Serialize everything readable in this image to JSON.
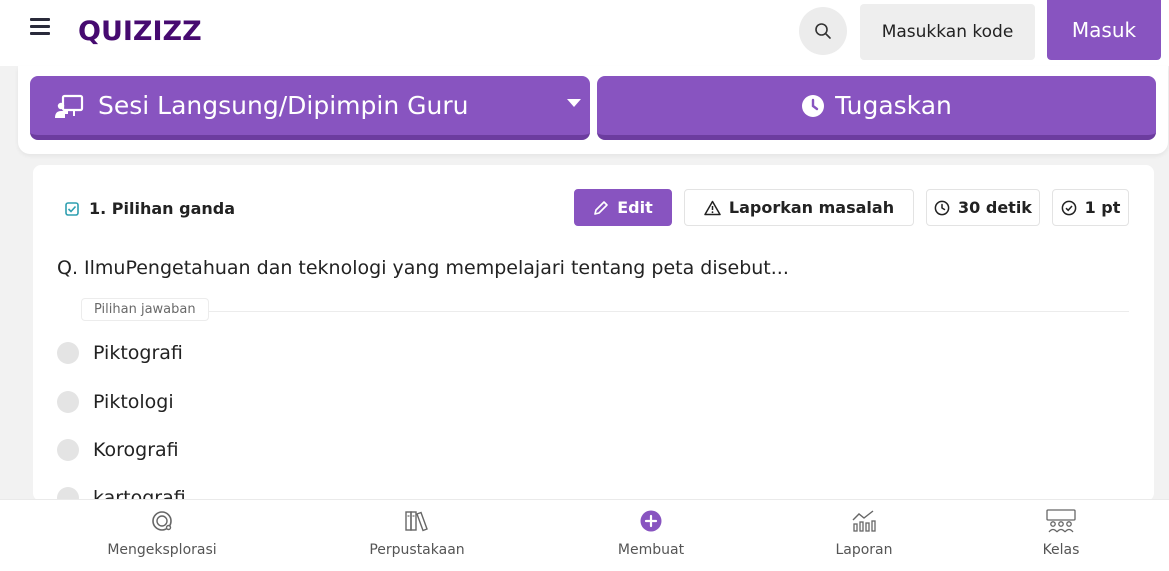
{
  "header": {
    "logo": "QUIZIZZ",
    "code_button": "Masukkan kode",
    "login_button": "Masuk"
  },
  "actions": {
    "session_label": "Sesi Langsung/Dipimpin Guru",
    "assign_label": "Tugaskan"
  },
  "question": {
    "type_label": "1. Pilihan ganda",
    "edit_label": "Edit",
    "report_label": "Laporkan masalah",
    "time_label": "30 detik",
    "points_label": "1 pt",
    "text": "Q. IlmuPengetahuan dan teknologi yang mempelajari tentang peta disebut...",
    "answers_label": "Pilihan jawaban",
    "options": [
      "Piktografi",
      "Piktologi",
      "Korografi",
      "kartografi"
    ]
  },
  "bottom_nav": {
    "items": [
      {
        "label": "Mengeksplorasi",
        "icon": "explore-icon"
      },
      {
        "label": "Perpustakaan",
        "icon": "library-icon"
      },
      {
        "label": "Membuat",
        "icon": "create-plus-icon"
      },
      {
        "label": "Laporan",
        "icon": "reports-chart-icon"
      },
      {
        "label": "Kelas",
        "icon": "class-group-icon"
      }
    ]
  },
  "colors": {
    "brand_purple": "#8854c0",
    "logo_purple": "#460a70"
  }
}
